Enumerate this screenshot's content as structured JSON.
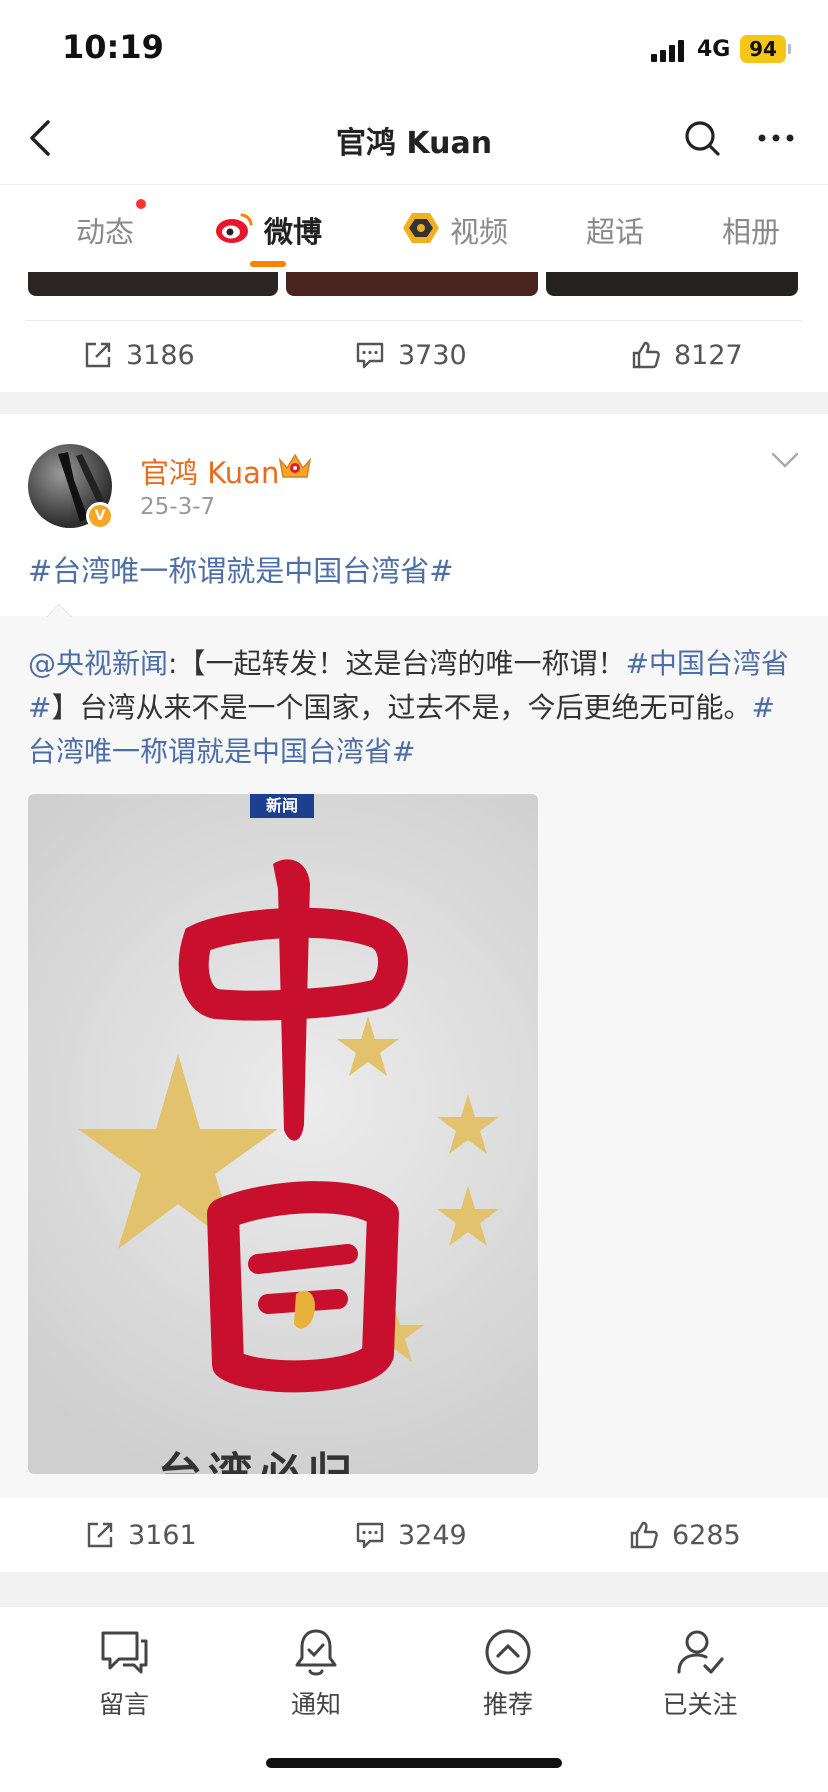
{
  "status_bar": {
    "time": "10:19",
    "network": "4G",
    "battery": "94"
  },
  "nav": {
    "title": "官鸿 Kuan",
    "back_icon": "chevron-left-icon",
    "search_icon": "search-icon",
    "more_icon": "more-icon"
  },
  "tabs": [
    {
      "label": "动态",
      "has_dot": true
    },
    {
      "label": "微博",
      "active": true,
      "icon": "weibo-icon"
    },
    {
      "label": "视频",
      "icon": "video-icon"
    },
    {
      "label": "超话"
    },
    {
      "label": "相册"
    }
  ],
  "prev_post": {
    "repost": "3186",
    "comment": "3730",
    "like": "8127"
  },
  "post": {
    "author": "官鸿 Kuan",
    "date": "25-3-7",
    "text": "#台湾唯一称谓就是中国台湾省#",
    "repost": {
      "mention": "@央视新闻",
      "colon": ":",
      "text1": "【一起转发！这是台湾的唯一称谓！",
      "tag1": "#中国台湾省#",
      "text2": "】台湾从来不是一个国家，过去不是，今后更绝无可能。",
      "tag2": "#台湾唯一称谓就是中国台湾省#",
      "image_badge": "新闻",
      "image_bottom_text": "台湾必归"
    },
    "stats": {
      "repost": "3161",
      "comment": "3249",
      "like": "6285"
    }
  },
  "bottom_tabs": [
    {
      "label": "留言",
      "icon": "message-icon"
    },
    {
      "label": "通知",
      "icon": "bell-icon"
    },
    {
      "label": "推荐",
      "icon": "recommend-icon"
    },
    {
      "label": "已关注",
      "icon": "followed-icon"
    }
  ],
  "colors": {
    "accent": "#ff8200",
    "link": "#4d6fa8",
    "author": "#e86b1f",
    "flag_red": "#c8102e",
    "star_gold": "#e2c26d"
  }
}
